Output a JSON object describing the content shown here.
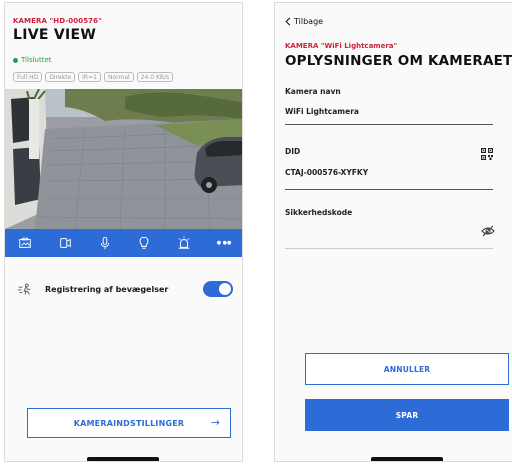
{
  "live_view": {
    "camera_label": "KAMERA \"HD-000576\"",
    "title": "LIVE VIEW",
    "status": "Tilsluttet",
    "chips": [
      "Full HD",
      "Direkte",
      "IR=1",
      "Normal",
      "24.0 KB/s"
    ],
    "toolbar": {
      "icons": [
        "snapshot-icon",
        "record-icon",
        "microphone-icon",
        "light-bulb-icon",
        "siren-icon"
      ],
      "more_label": "● ●●"
    },
    "motion": {
      "label": "Registrering af bevægelser",
      "enabled": true
    },
    "settings_button": "KAMERAINDSTILLINGER",
    "settings_arrow": "→"
  },
  "camera_info": {
    "back_label": "Tilbage",
    "camera_label": "KAMERA \"WiFi Lightcamera\"",
    "title": "OPLYSNINGER OM KAMERAET",
    "name_label": "Kamera navn",
    "name_value": "WiFi Lightcamera",
    "did_label": "DID",
    "did_value": "CTAJ-000576-XYFKY",
    "security_label": "Sikkerhedskode",
    "security_value": "",
    "cancel_button": "ANNULLER",
    "save_button": "SPAR"
  },
  "colors": {
    "accent": "#2d6bd6",
    "camera_label": "#d0203a",
    "status": "#1fa14b"
  }
}
